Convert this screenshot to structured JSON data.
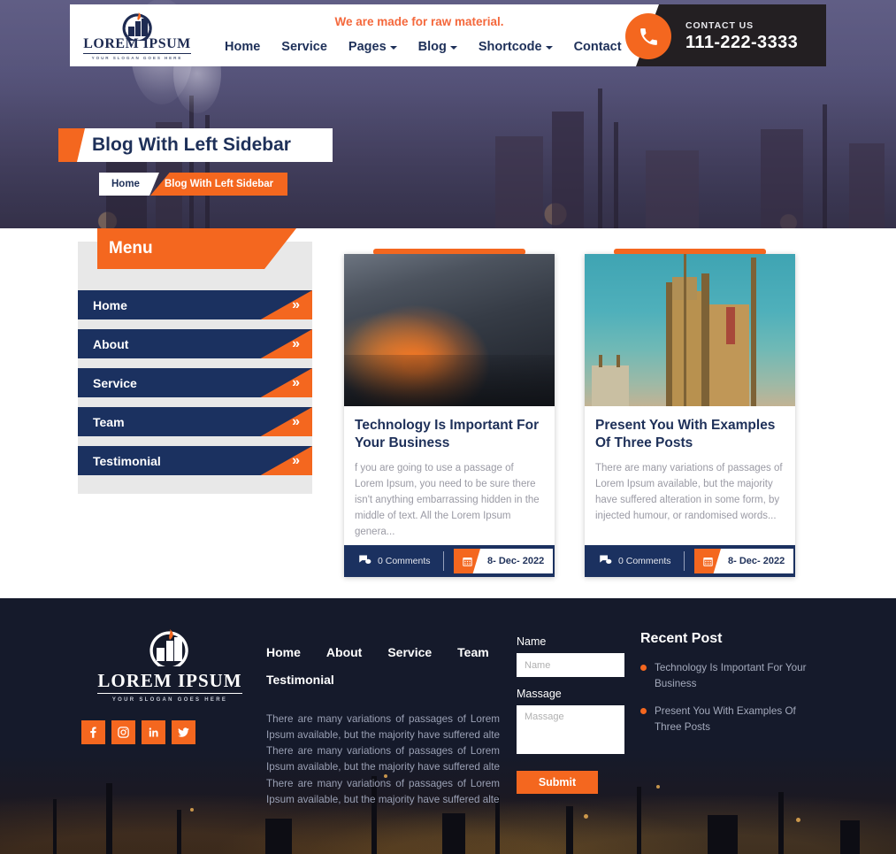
{
  "brand": {
    "name": "LOREM IPSUM",
    "slogan": "YOUR SLOGAN GOES HERE",
    "logo_icon": "factory-logo-icon"
  },
  "header": {
    "tagline": "We are made for raw material.",
    "nav": [
      {
        "label": "Home",
        "has_caret": false
      },
      {
        "label": "Service",
        "has_caret": false
      },
      {
        "label": "Pages",
        "has_caret": true
      },
      {
        "label": "Blog",
        "has_caret": true
      },
      {
        "label": "Shortcode",
        "has_caret": true
      },
      {
        "label": "Contact",
        "has_caret": false
      }
    ],
    "contact": {
      "label": "CONTACT US",
      "number": "111-222-3333",
      "icon": "phone-icon"
    }
  },
  "banner": {
    "title": "Blog With Left Sidebar",
    "breadcrumb": {
      "home": "Home",
      "current": "Blog With Left Sidebar"
    }
  },
  "sidebar": {
    "heading": "Menu",
    "items": [
      {
        "label": "Home",
        "icon": "double-chevron-right-icon"
      },
      {
        "label": "About",
        "icon": "double-chevron-right-icon"
      },
      {
        "label": "Service",
        "icon": "double-chevron-right-icon"
      },
      {
        "label": "Team",
        "icon": "double-chevron-right-icon"
      },
      {
        "label": "Testimonial",
        "icon": "double-chevron-right-icon"
      }
    ]
  },
  "posts": [
    {
      "title": "Technology Is Important For Your Business",
      "excerpt": "f you are going to use a passage of Lorem Ipsum, you need to be sure there isn't anything embarrassing hidden in the middle of text. All the Lorem Ipsum genera...",
      "comments": "0 Comments",
      "date": "8- Dec- 2022",
      "image": "metal-grinding-sparks-photo"
    },
    {
      "title": "Present You With Examples Of Three Posts",
      "excerpt": "There are many variations of passages of Lorem Ipsum available, but the majority have suffered alteration in some form, by injected humour, or randomised words...",
      "comments": "0 Comments",
      "date": "8- Dec- 2022",
      "image": "refinery-plant-photo"
    }
  ],
  "footer": {
    "links": [
      "Home",
      "About",
      "Service",
      "Team",
      "Testimonial"
    ],
    "about_text": "There are many variations of passages of Lorem Ipsum available, but the majority have suffered alte There are many variations of passages of Lorem Ipsum available, but the majority have suffered alte There are many variations of passages of Lorem Ipsum available, but the majority have suffered alte",
    "socials": [
      {
        "name": "facebook-icon",
        "glyph": "f"
      },
      {
        "name": "instagram-icon",
        "glyph": ""
      },
      {
        "name": "linkedin-icon",
        "glyph": "in"
      },
      {
        "name": "twitter-icon",
        "glyph": ""
      }
    ],
    "form": {
      "name_label": "Name",
      "name_placeholder": "Name",
      "name_value": "",
      "message_label": "Massage",
      "message_placeholder": "Massage",
      "message_value": "",
      "submit_label": "Submit"
    },
    "recent": {
      "title": "Recent Post",
      "items": [
        "Technology Is Important For Your Business",
        "Present You With Examples Of Three Posts"
      ]
    }
  },
  "colors": {
    "orange": "#f4671f",
    "navy": "#1b3160",
    "title_navy": "#1e3059",
    "footer_bg": "#151a2b",
    "muted": "#9a9aa4"
  }
}
